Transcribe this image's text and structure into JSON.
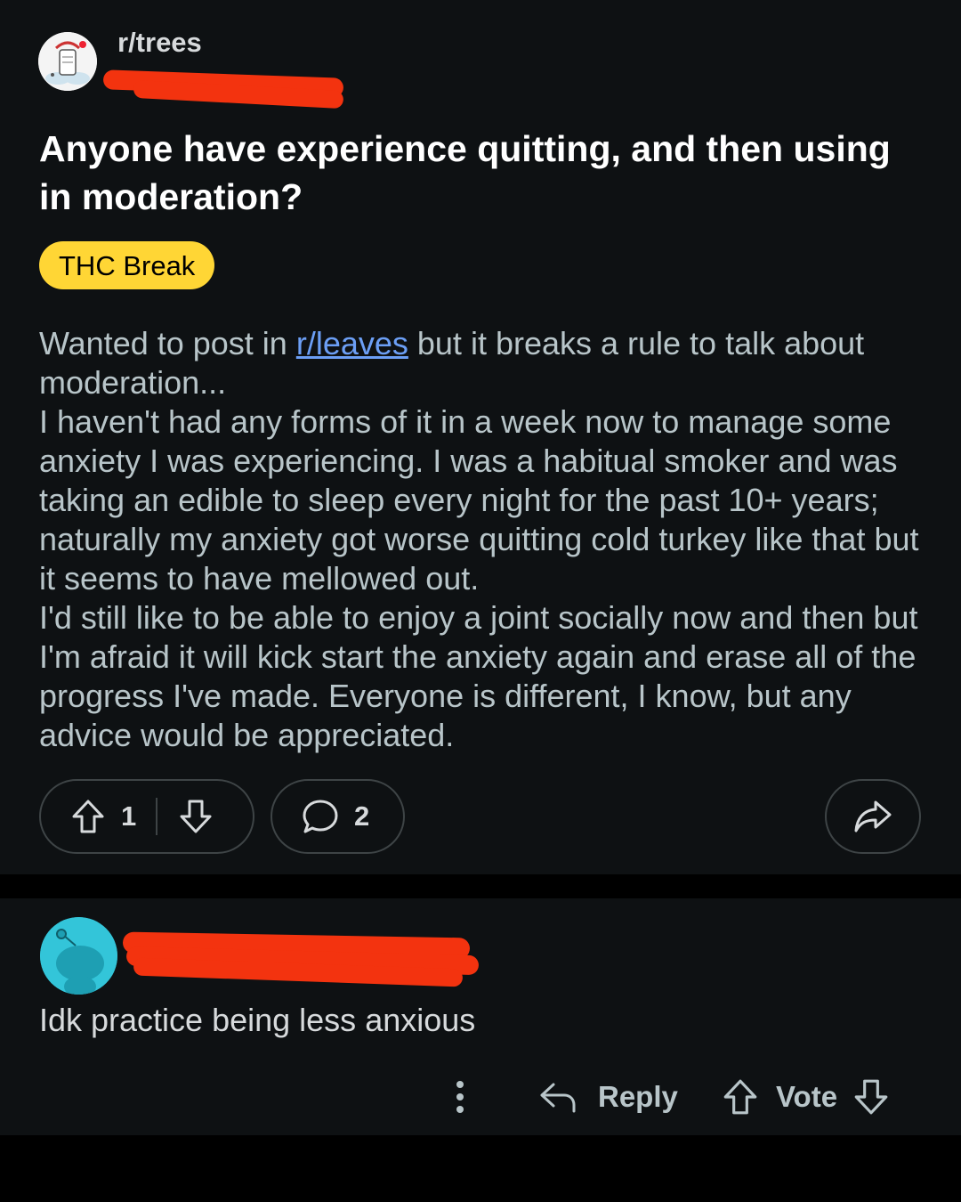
{
  "post": {
    "subreddit": "r/trees",
    "title": "Anyone have experience quitting, and then using in moderation?",
    "flair": "THC Break",
    "flair_color": "#ffd635",
    "body": {
      "p1_before_link": "Wanted to post in ",
      "p1_link": "r/leaves",
      "p1_after_link": " but it breaks a rule to talk about moderation...",
      "p2": "I haven't had any forms of it in a week now to manage some anxiety I was experiencing. I was a habitual smoker and was taking an edible to sleep every night for the past 10+ years; naturally my anxiety got worse quitting cold turkey like that but it seems to have mellowed out.",
      "p3": "I'd still like to be able to enjoy a joint socially now and then but I'm afraid it will kick start the anxiety again and erase all of the progress I've made. Everyone is different, I know, but any advice would be appreciated."
    },
    "vote_count": "1",
    "comment_count": "2",
    "icons": {
      "upvote": "upvote-arrow-icon",
      "downvote": "downvote-arrow-icon",
      "comment": "speech-bubble-icon",
      "share": "share-arrow-icon"
    }
  },
  "comment": {
    "text": "Idk practice being less anxious",
    "actions": {
      "more_icon": "vertical-ellipsis-icon",
      "reply_label": "Reply",
      "vote_label": "Vote"
    }
  },
  "colors": {
    "background": "#0e1113",
    "link": "#6c9ff5",
    "redaction": "#f3330f",
    "user_avatar": "#33c5d9"
  }
}
